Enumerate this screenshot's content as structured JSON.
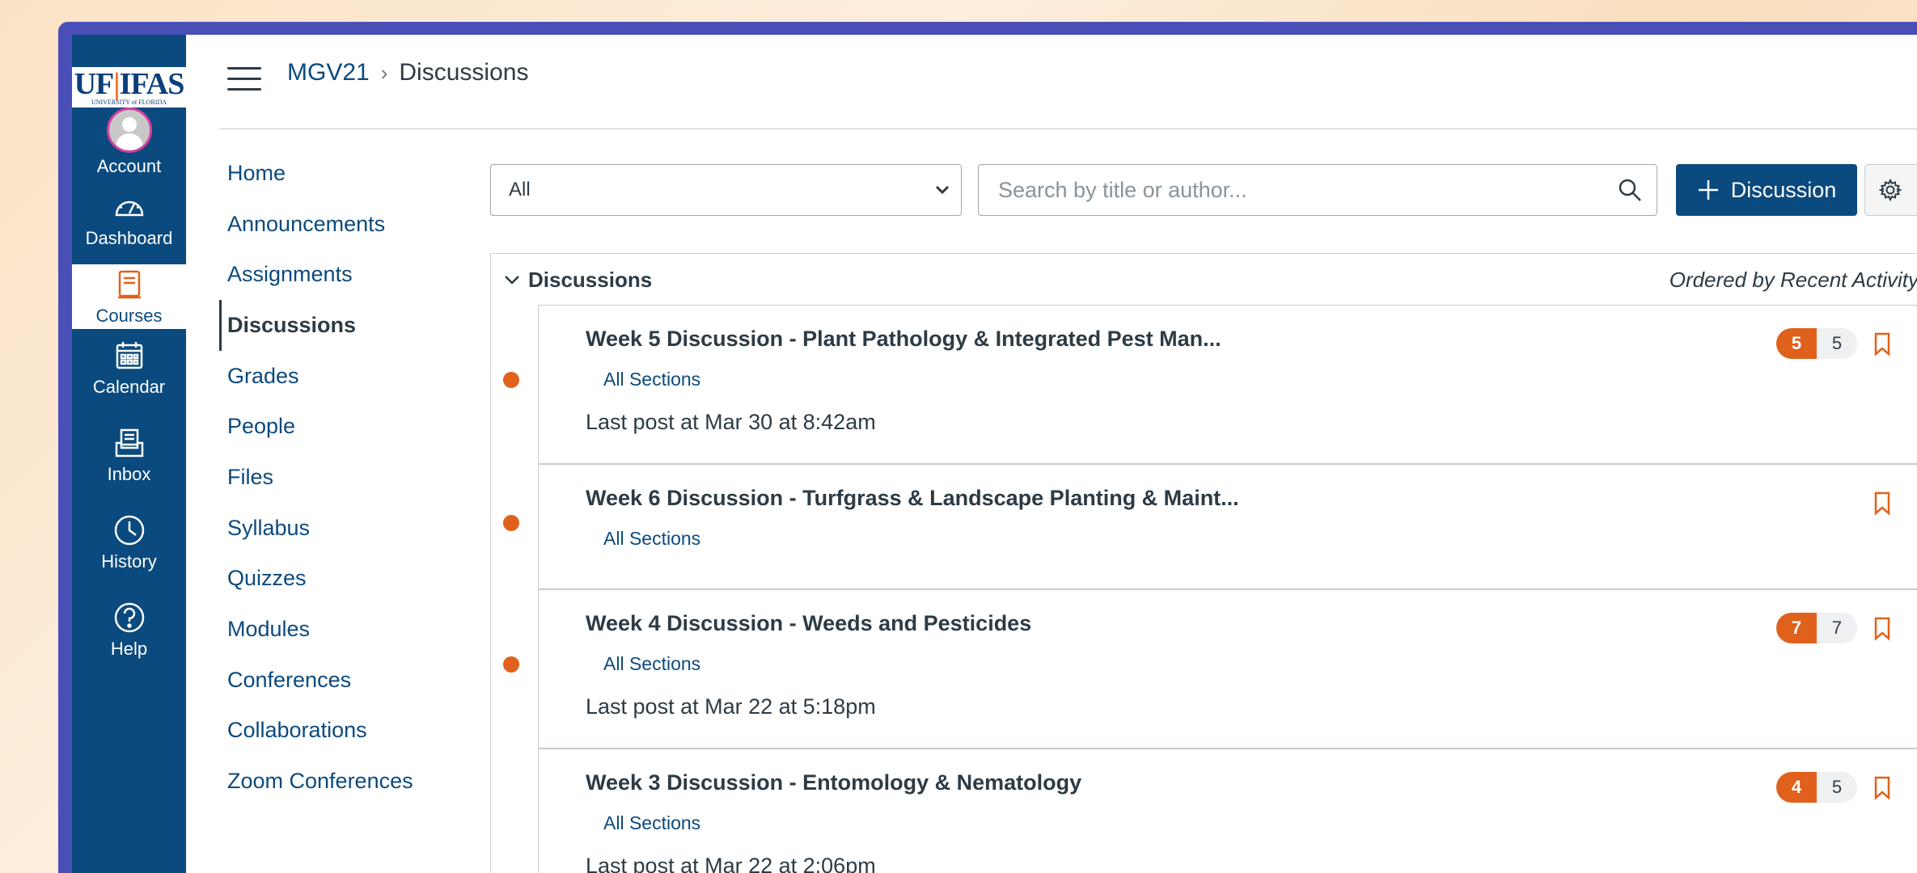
{
  "gnav": {
    "logo_main_left": "UF",
    "logo_main_right": "IFAS",
    "logo_sub": "UNIVERSITY of FLORIDA",
    "items": [
      {
        "label": "Account",
        "icon": "avatar"
      },
      {
        "label": "Dashboard",
        "icon": "dashboard-icon"
      },
      {
        "label": "Courses",
        "icon": "courses-icon"
      },
      {
        "label": "Calendar",
        "icon": "calendar-icon"
      },
      {
        "label": "Inbox",
        "icon": "inbox-icon"
      },
      {
        "label": "History",
        "icon": "history-icon"
      },
      {
        "label": "Help",
        "icon": "help-icon"
      }
    ]
  },
  "header": {
    "course": "MGV21",
    "separator": "›",
    "page": "Discussions"
  },
  "course_nav": {
    "items": [
      "Home",
      "Announcements",
      "Assignments",
      "Discussions",
      "Grades",
      "People",
      "Files",
      "Syllabus",
      "Quizzes",
      "Modules",
      "Conferences",
      "Collaborations",
      "Zoom Conferences"
    ],
    "active": "Discussions"
  },
  "toolbar": {
    "filter_value": "All",
    "search_placeholder": "Search by title or author...",
    "add_label": "Discussion"
  },
  "discussions": {
    "heading": "Discussions",
    "order_label": "Ordered by Recent Activity",
    "rows": [
      {
        "title": "Week 5 Discussion - Plant Pathology & Integrated Pest Man...",
        "sections": "All Sections",
        "last_post": "Last post at Mar 30 at 8:42am",
        "unread": "5",
        "total": "5"
      },
      {
        "title": "Week 6 Discussion - Turfgrass & Landscape Planting & Maint...",
        "sections": "All Sections",
        "last_post": "",
        "unread": "",
        "total": ""
      },
      {
        "title": "Week 4 Discussion - Weeds and Pesticides",
        "sections": "All Sections",
        "last_post": "Last post at Mar 22 at 5:18pm",
        "unread": "7",
        "total": "7"
      },
      {
        "title": "Week 3 Discussion - Entomology & Nematology",
        "sections": "All Sections",
        "last_post": "Last post at Mar 22 at 2:06pm",
        "unread": "4",
        "total": "5"
      }
    ]
  },
  "colors": {
    "nav_bg": "#0b4a7e",
    "accent_orange": "#e0611b",
    "frame": "#4a4fb8",
    "text": "#2d3b45"
  }
}
